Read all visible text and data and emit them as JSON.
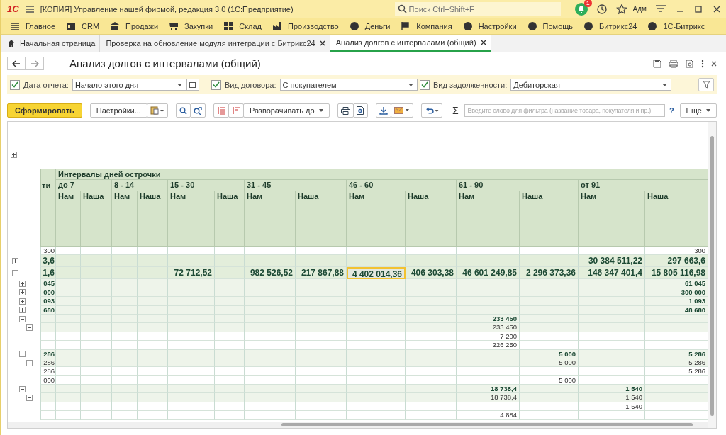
{
  "app": {
    "title": "[КОПИЯ] Управление нашей фирмой, редакция 3.0  (1С:Предприятие)",
    "logo": "1С",
    "search": {
      "placeholder": "Поиск Ctrl+Shift+F"
    },
    "notifications": "1",
    "user": "Адм"
  },
  "menu": [
    "Главное",
    "CRM",
    "Продажи",
    "Закупки",
    "Склад",
    "Производство",
    "Деньги",
    "Компания",
    "Настройки",
    "Помощь",
    "Битрикс24",
    "1С-Битрикс"
  ],
  "tabs": [
    {
      "label": "Начальная страница",
      "selected": false,
      "closable": false
    },
    {
      "label": "Проверка на обновление модуля интеграции с Битрикс24",
      "selected": false,
      "closable": true
    },
    {
      "label": "Анализ долгов с интервалами (общий)",
      "selected": true,
      "closable": true
    }
  ],
  "form": {
    "title": "Анализ долгов с интервалами (общий)"
  },
  "filters": [
    {
      "label": "Дата отчета:",
      "checked": true,
      "value": "Начало этого дня",
      "kind": "date"
    },
    {
      "label": "Вид договора:",
      "checked": true,
      "value": "С покупателем",
      "kind": "select"
    },
    {
      "label": "Вид задолженности:",
      "checked": true,
      "value": "Дебиторская",
      "kind": "select"
    }
  ],
  "toolbar": {
    "generate": "Сформировать",
    "settings": "Настройки...",
    "expand": "Разворачивать до",
    "sum": "Σ",
    "search": {
      "placeholder": "Введите слово для фильтра (название товара, покупателя и пр.)"
    },
    "help": "?",
    "more": "Еще"
  },
  "table": {
    "header_expanded": false,
    "first_column": "ти",
    "group_title": "Интервалы дней острочки",
    "groups": [
      {
        "label": "до 7",
        "columns": [
          {
            "label": "Нам",
            "selected": false
          },
          {
            "label": "Наша",
            "selected": false
          }
        ]
      },
      {
        "label": "8 - 14",
        "columns": [
          {
            "label": "Нам",
            "selected": false
          },
          {
            "label": "Наша",
            "selected": false
          }
        ]
      },
      {
        "label": "15 - 30",
        "columns": [
          {
            "label": "Нам",
            "selected": false
          },
          {
            "label": "Наша",
            "selected": false
          }
        ]
      },
      {
        "label": "31 - 45",
        "columns": [
          {
            "label": "Нам",
            "selected": false
          },
          {
            "label": "Наша",
            "selected": false
          }
        ]
      },
      {
        "label": "46 - 60",
        "columns": [
          {
            "label": "Нам",
            "selected": true
          },
          {
            "label": "Наша",
            "selected": false
          }
        ]
      },
      {
        "label": "61 - 90",
        "columns": [
          {
            "label": "Нам",
            "selected": false
          },
          {
            "label": "Наша",
            "selected": false
          }
        ]
      },
      {
        "label": "от 91",
        "columns": [
          {
            "label": "Нам",
            "selected": false
          },
          {
            "label": "Наша",
            "selected": false
          }
        ]
      }
    ],
    "rows": [
      {
        "kind": "detail",
        "selected": false,
        "cells": [
          "300",
          null,
          null,
          null,
          null,
          null,
          null,
          null,
          null,
          null,
          null,
          null,
          null,
          null,
          "300"
        ]
      },
      {
        "kind": "total",
        "selected": false,
        "expanded": false,
        "cells": [
          "3,6",
          null,
          null,
          null,
          null,
          null,
          null,
          null,
          null,
          null,
          null,
          null,
          null,
          "30 384 511,22",
          "297 663,6"
        ]
      },
      {
        "kind": "total",
        "selected": true,
        "expanded": true,
        "cells": [
          "1,6",
          null,
          null,
          null,
          null,
          "72 712,52",
          null,
          "982 526,52",
          "217 867,88",
          "4 402 014,36",
          "406 303,38",
          "46 601 249,85",
          "2 296 373,36",
          "146 347 401,4",
          "15 805 116,98"
        ],
        "children": [
          {
            "kind": "group",
            "selected": false,
            "expanded": false,
            "cells": [
              "045",
              null,
              null,
              null,
              null,
              null,
              null,
              null,
              null,
              null,
              null,
              null,
              null,
              null,
              "61 045"
            ]
          },
          {
            "kind": "group",
            "selected": false,
            "expanded": false,
            "cells": [
              "000",
              null,
              null,
              null,
              null,
              null,
              null,
              null,
              null,
              null,
              null,
              null,
              null,
              null,
              "300 000"
            ]
          },
          {
            "kind": "group",
            "selected": false,
            "expanded": false,
            "cells": [
              "093",
              null,
              null,
              null,
              null,
              null,
              null,
              null,
              null,
              null,
              null,
              null,
              null,
              null,
              "1 093"
            ]
          },
          {
            "kind": "group",
            "selected": false,
            "expanded": false,
            "cells": [
              "680",
              null,
              null,
              null,
              null,
              null,
              null,
              null,
              null,
              null,
              null,
              null,
              null,
              null,
              "48 680"
            ]
          },
          {
            "kind": "group",
            "selected": false,
            "expanded": true,
            "cells": [
              null,
              null,
              null,
              null,
              null,
              null,
              null,
              null,
              null,
              null,
              null,
              "233 450",
              null,
              null,
              null
            ],
            "children": [
              {
                "kind": "subgroup",
                "selected": false,
                "expanded": true,
                "cells": [
                  null,
                  null,
                  null,
                  null,
                  null,
                  null,
                  null,
                  null,
                  null,
                  null,
                  null,
                  "233 450",
                  null,
                  null,
                  null
                ],
                "children": [
                  {
                    "kind": "detail",
                    "selected": false,
                    "cells": [
                      null,
                      null,
                      null,
                      null,
                      null,
                      null,
                      null,
                      null,
                      null,
                      null,
                      null,
                      "7 200",
                      null,
                      null,
                      null
                    ]
                  },
                  {
                    "kind": "detail",
                    "selected": false,
                    "cells": [
                      null,
                      null,
                      null,
                      null,
                      null,
                      null,
                      null,
                      null,
                      null,
                      null,
                      null,
                      "226 250",
                      null,
                      null,
                      null
                    ]
                  }
                ]
              }
            ]
          },
          {
            "kind": "group",
            "selected": false,
            "expanded": true,
            "cells": [
              "286",
              null,
              null,
              null,
              null,
              null,
              null,
              null,
              null,
              null,
              null,
              null,
              "5 000",
              null,
              "5 286"
            ],
            "children": [
              {
                "kind": "subgroup",
                "selected": false,
                "expanded": true,
                "cells": [
                  "286",
                  null,
                  null,
                  null,
                  null,
                  null,
                  null,
                  null,
                  null,
                  null,
                  null,
                  null,
                  "5 000",
                  null,
                  "5 286"
                ],
                "children": [
                  {
                    "kind": "detail",
                    "selected": false,
                    "cells": [
                      "286",
                      null,
                      null,
                      null,
                      null,
                      null,
                      null,
                      null,
                      null,
                      null,
                      null,
                      null,
                      null,
                      null,
                      "5 286"
                    ]
                  },
                  {
                    "kind": "detail",
                    "selected": false,
                    "cells": [
                      "000",
                      null,
                      null,
                      null,
                      null,
                      null,
                      null,
                      null,
                      null,
                      null,
                      null,
                      null,
                      "5 000",
                      null,
                      null
                    ]
                  }
                ]
              }
            ]
          },
          {
            "kind": "group",
            "selected": false,
            "expanded": true,
            "cells": [
              null,
              null,
              null,
              null,
              null,
              null,
              null,
              null,
              null,
              null,
              null,
              "18 738,4",
              null,
              "1 540",
              null
            ],
            "children": [
              {
                "kind": "subgroup",
                "selected": false,
                "expanded": true,
                "cells": [
                  null,
                  null,
                  null,
                  null,
                  null,
                  null,
                  null,
                  null,
                  null,
                  null,
                  null,
                  "18 738,4",
                  null,
                  "1 540",
                  null
                ],
                "children": [
                  {
                    "kind": "detail",
                    "selected": false,
                    "cells": [
                      null,
                      null,
                      null,
                      null,
                      null,
                      null,
                      null,
                      null,
                      null,
                      null,
                      null,
                      null,
                      null,
                      "1 540",
                      null
                    ]
                  },
                  {
                    "kind": "detail",
                    "selected": false,
                    "cells": [
                      null,
                      null,
                      null,
                      null,
                      null,
                      null,
                      null,
                      null,
                      null,
                      null,
                      null,
                      "4 884",
                      null,
                      null,
                      null
                    ]
                  }
                ]
              }
            ]
          }
        ]
      }
    ]
  }
}
